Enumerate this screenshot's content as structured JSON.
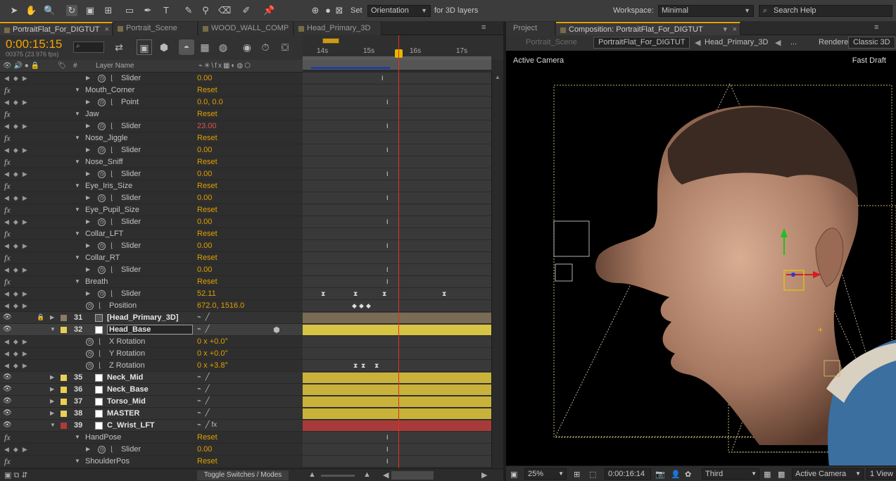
{
  "toolbar": {
    "set_label": "Set",
    "orientation_value": "Orientation",
    "for_3d_label": "for 3D layers",
    "workspace_label": "Workspace:",
    "workspace_value": "Minimal",
    "search_placeholder": "Search Help"
  },
  "timeline": {
    "tabs": [
      {
        "label": "PortraitFlat_For_DIGTUT",
        "active": true
      },
      {
        "label": "Portrait_Scene"
      },
      {
        "label": "WOOD_WALL_COMP"
      },
      {
        "label": "Head_Primary_3D"
      }
    ],
    "timecode": "0:00:15:15",
    "frame_info": "00375 (23.976 fps)",
    "column_number": "#",
    "column_layer_name": "Layer Name",
    "ruler_ticks": [
      "14s",
      "15s",
      "16s",
      "17s"
    ],
    "toggle_label": "Toggle Switches / Modes"
  },
  "rows": [
    {
      "kind": "prop",
      "name": "Slider",
      "value": "0.00",
      "indent": 2
    },
    {
      "kind": "fx",
      "name": "Mouth_Corner",
      "value": "Reset"
    },
    {
      "kind": "prop",
      "name": "Point",
      "value": "0.0, 0.0",
      "indent": 2
    },
    {
      "kind": "fx",
      "name": "Jaw",
      "value": "Reset"
    },
    {
      "kind": "prop",
      "name": "Slider",
      "value": "23.00",
      "indent": 2,
      "red": true
    },
    {
      "kind": "fx",
      "name": "Nose_Jiggle",
      "value": "Reset"
    },
    {
      "kind": "prop",
      "name": "Slider",
      "value": "0.00",
      "indent": 2
    },
    {
      "kind": "fx",
      "name": "Nose_Sniff",
      "value": "Reset"
    },
    {
      "kind": "prop",
      "name": "Slider",
      "value": "0.00",
      "indent": 2
    },
    {
      "kind": "fx",
      "name": "Eye_Iris_Size",
      "value": "Reset"
    },
    {
      "kind": "prop",
      "name": "Slider",
      "value": "0.00",
      "indent": 2
    },
    {
      "kind": "fx",
      "name": "Eye_Pupil_Size",
      "value": "Reset"
    },
    {
      "kind": "prop",
      "name": "Slider",
      "value": "0.00",
      "indent": 2
    },
    {
      "kind": "fx",
      "name": "Collar_LFT",
      "value": "Reset"
    },
    {
      "kind": "prop",
      "name": "Slider",
      "value": "0.00",
      "indent": 2
    },
    {
      "kind": "fx",
      "name": "Collar_RT",
      "value": "Reset"
    },
    {
      "kind": "prop",
      "name": "Slider",
      "value": "0.00",
      "indent": 2
    },
    {
      "kind": "fx",
      "name": "Breath",
      "value": "Reset"
    },
    {
      "kind": "prop",
      "name": "Slider",
      "value": "52.11",
      "indent": 2
    },
    {
      "kind": "prop",
      "name": "Position",
      "value": "672.0, 1516.0",
      "indent": 1
    },
    {
      "kind": "layer",
      "num": "31",
      "name": "[Head_Primary_3D]",
      "color": "#8a7c62"
    },
    {
      "kind": "layer",
      "num": "32",
      "name": "Head_Base",
      "color": "#e8cf55",
      "selected": true
    },
    {
      "kind": "prop",
      "name": "X Rotation",
      "value": "0 x +0.0°",
      "indent": 1
    },
    {
      "kind": "prop",
      "name": "Y Rotation",
      "value": "0 x +0.0°",
      "indent": 1
    },
    {
      "kind": "prop",
      "name": "Z Rotation",
      "value": "0 x +3.8°",
      "indent": 1
    },
    {
      "kind": "layer",
      "num": "35",
      "name": "Neck_Mid",
      "color": "#e8cf55"
    },
    {
      "kind": "layer",
      "num": "36",
      "name": "Neck_Base",
      "color": "#e8cf55"
    },
    {
      "kind": "layer",
      "num": "37",
      "name": "Torso_Mid",
      "color": "#e8cf55"
    },
    {
      "kind": "layer",
      "num": "38",
      "name": "MASTER",
      "color": "#e8cf55"
    },
    {
      "kind": "layer",
      "num": "39",
      "name": "C_Wrist_LFT",
      "color": "#b03a3a"
    },
    {
      "kind": "fx",
      "name": "HandPose",
      "value": "Reset"
    },
    {
      "kind": "prop",
      "name": "Slider",
      "value": "0.00",
      "indent": 2
    },
    {
      "kind": "fx",
      "name": "ShoulderPos",
      "value": "Reset"
    }
  ],
  "composition": {
    "project_tab": "Project",
    "comp_tab": "Composition: PortraitFlat_For_DIGTUT",
    "flow": [
      "Portrait_Scene",
      "PortraitFlat_For_DIGTUT",
      "Head_Primary_3D",
      "..."
    ],
    "renderer_label": "Renderer:",
    "renderer_value": "Classic 3D",
    "active_camera": "Active Camera",
    "fast_draft": "Fast Draft",
    "zoom": "25%",
    "timecode": "0:00:16:14",
    "view_layout": "Third",
    "camera_view": "Active Camera",
    "views": "1 View"
  },
  "colors": {
    "accent": "#f5a600",
    "current_time_indicator": "#e03020",
    "layer_yellow": "#c9b23a",
    "layer_red": "#a83a3a"
  }
}
